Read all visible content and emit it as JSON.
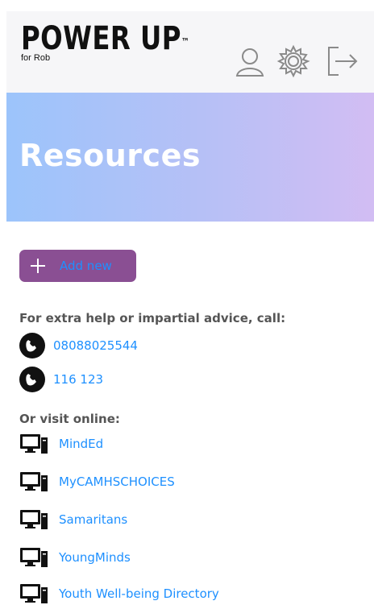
{
  "header": {
    "logo_main": "POWER UP",
    "logo_tm": "™",
    "logo_sub": "for Rob",
    "icons": [
      "user-icon",
      "gear-icon",
      "logout-icon"
    ]
  },
  "banner": {
    "title": "Resources"
  },
  "add_button": {
    "label": "Add new"
  },
  "help": {
    "text": "For extra help or impartial advice, call:",
    "phones": [
      "08088025544",
      "116 123"
    ]
  },
  "visit": {
    "text": "Or visit online:",
    "sites": [
      "MindEd",
      "MyCAMHSCHOICES",
      "Samaritans",
      "YoungMinds",
      "Youth Well-being Directory"
    ]
  },
  "colors": {
    "link": "#1e90ff",
    "button_bg": "#8a4f93",
    "banner_start": "#9cc4fb",
    "banner_end": "#d2bdf3",
    "header_bg": "#f6f6f8"
  }
}
